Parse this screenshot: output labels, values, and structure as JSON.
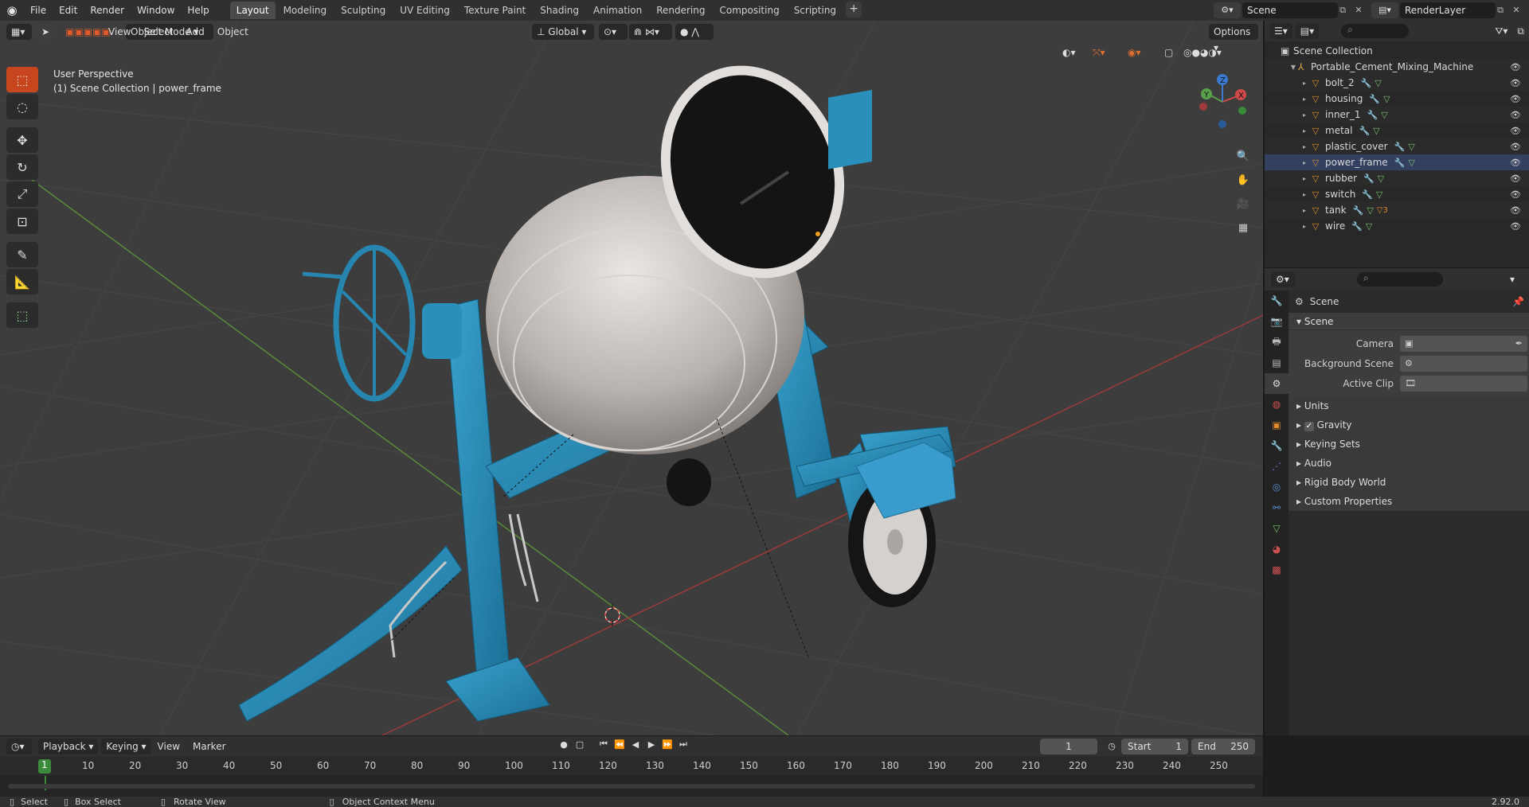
{
  "topbar": {
    "menus": [
      "File",
      "Edit",
      "Render",
      "Window",
      "Help"
    ],
    "workspaces": [
      "Layout",
      "Modeling",
      "Sculpting",
      "UV Editing",
      "Texture Paint",
      "Shading",
      "Animation",
      "Rendering",
      "Compositing",
      "Scripting"
    ],
    "active_workspace": "Layout",
    "add_label": "+",
    "scene_name": "Scene",
    "view_layer": "RenderLayer"
  },
  "viewport": {
    "mode": "Object Mode",
    "menus": [
      "View",
      "Select",
      "Add",
      "Object"
    ],
    "transform_orientation": "Global",
    "options_label": "Options",
    "perspective_label": "User Perspective",
    "collection_label": "(1) Scene Collection | power_frame",
    "gizmo": {
      "z": "Z",
      "y": "Y",
      "x": "X"
    }
  },
  "outliner": {
    "root": "Scene Collection",
    "collection": "Portable_Cement_Mixing_Machine",
    "items": [
      {
        "name": "bolt_2"
      },
      {
        "name": "housing"
      },
      {
        "name": "inner_1"
      },
      {
        "name": "metal"
      },
      {
        "name": "plastic_cover"
      },
      {
        "name": "power_frame"
      },
      {
        "name": "rubber"
      },
      {
        "name": "switch"
      },
      {
        "name": "tank",
        "badge": "3"
      },
      {
        "name": "wire"
      }
    ],
    "selected": "power_frame"
  },
  "properties": {
    "header_title": "Scene",
    "panel_title": "Scene",
    "camera_label": "Camera",
    "background_scene_label": "Background Scene",
    "active_clip_label": "Active Clip",
    "subpanels": [
      "Units",
      "Gravity",
      "Keying Sets",
      "Audio",
      "Rigid Body World",
      "Custom Properties"
    ],
    "gravity_checked": true
  },
  "timeline": {
    "menus": [
      "Playback",
      "Keying",
      "View",
      "Marker"
    ],
    "current_frame": "1",
    "start_label": "Start",
    "start": "1",
    "end_label": "End",
    "end": "250",
    "ruler": [
      "10",
      "20",
      "30",
      "40",
      "50",
      "60",
      "70",
      "80",
      "90",
      "100",
      "110",
      "120",
      "130",
      "140",
      "150",
      "160",
      "170",
      "180",
      "190",
      "200",
      "210",
      "220",
      "230",
      "240",
      "250"
    ]
  },
  "statusbar": {
    "select": "Select",
    "box_select": "Box Select",
    "rotate_view": "Rotate View",
    "context_menu": "Object Context Menu",
    "version": "2.92.0"
  }
}
